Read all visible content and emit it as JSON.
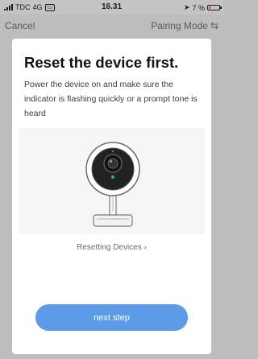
{
  "status_bar": {
    "carrier": "TDC",
    "network": "4G",
    "time": "16.31",
    "battery_percent": "7 %",
    "icons": [
      "signal-icon",
      "location-arrow-icon",
      "battery-icon"
    ]
  },
  "nav": {
    "cancel_label": "Cancel",
    "mode_label": "Pairing Mode",
    "mode_icon": "swap-icon"
  },
  "card": {
    "title": "Reset the device first.",
    "description": "Power the device on and make sure the indicator is flashing quickly or a prompt tone is heard",
    "illustration": "security-camera",
    "resetting_link": "Resetting Devices",
    "next_button": "next step"
  },
  "colors": {
    "primary_button": "#5b9be8",
    "indicator_led": "#2fbf4f",
    "background": "#bdbdbd"
  }
}
